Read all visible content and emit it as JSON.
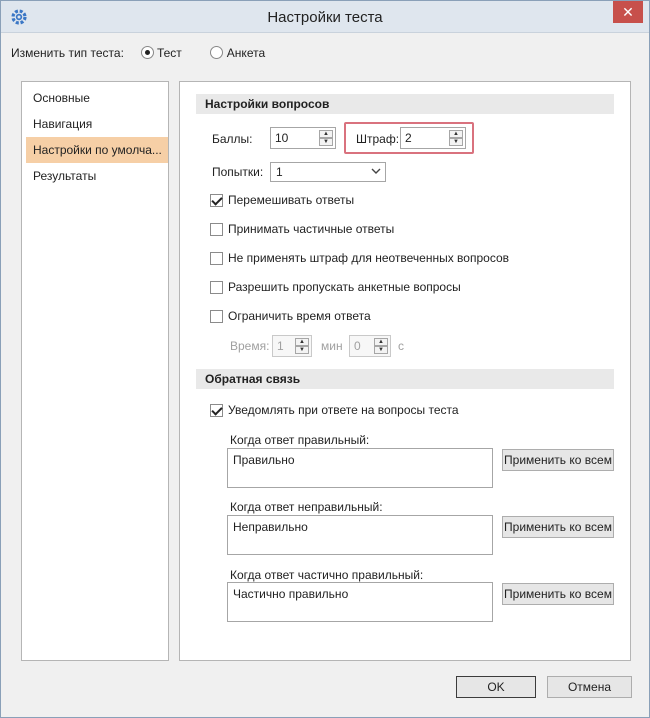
{
  "window": {
    "title": "Настройки теста",
    "close_label": "✕"
  },
  "test_type": {
    "label": "Изменить тип теста:",
    "options": [
      {
        "label": "Тест",
        "selected": true
      },
      {
        "label": "Анкета",
        "selected": false
      }
    ]
  },
  "sidebar": {
    "items": [
      {
        "label": "Основные"
      },
      {
        "label": "Навигация"
      },
      {
        "label": "Настройки по умолча..."
      },
      {
        "label": "Результаты"
      }
    ]
  },
  "questions": {
    "header": "Настройки вопросов",
    "points_label": "Баллы:",
    "points_value": "10",
    "penalty_label": "Штраф:",
    "penalty_value": "2",
    "attempts_label": "Попытки:",
    "attempts_value": "1",
    "shuffle_label": "Перемешивать ответы",
    "partial_label": "Принимать частичные ответы",
    "no_penalty_label": "Не применять штраф для неотвеченных вопросов",
    "skip_survey_label": "Разрешить пропускать анкетные вопросы",
    "limit_time_label": "Ограничить время ответа",
    "time_label": "Время:",
    "minutes_value": "1",
    "minutes_unit": "мин",
    "seconds_value": "0",
    "seconds_unit": "с"
  },
  "feedback": {
    "header": "Обратная связь",
    "notify_label": "Уведомлять при ответе на вопросы теста",
    "correct_label": "Когда ответ правильный:",
    "correct_text": "Правильно",
    "incorrect_label": "Когда ответ неправильный:",
    "incorrect_text": "Неправильно",
    "partial_label": "Когда ответ частично правильный:",
    "partial_text": "Частично правильно",
    "apply_all_label": "Применить ко всем"
  },
  "footer": {
    "ok_label": "OK",
    "cancel_label": "Отмена"
  },
  "colors": {
    "selected_nav": "#f6cfa6",
    "highlight_border": "#d9727e",
    "close_button": "#c7504b"
  }
}
